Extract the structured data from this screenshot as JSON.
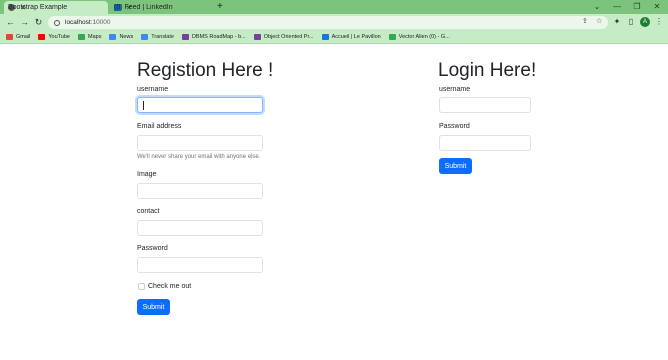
{
  "browser": {
    "tabs": [
      {
        "title": "Bootstrap Example",
        "active": true
      },
      {
        "title": "(0) Feed | LinkedIn",
        "active": false
      }
    ],
    "new_tab": "+",
    "window_controls": [
      "⌄",
      "—",
      "❐",
      "✕"
    ],
    "nav": {
      "back": "←",
      "forward": "→",
      "reload": "↻"
    },
    "address": {
      "host": "localhost",
      "port": ":10000"
    },
    "profile_initial": "A",
    "bookmarks": [
      {
        "label": "Gmail",
        "color": "#ea4335"
      },
      {
        "label": "YouTube",
        "color": "#ff0000"
      },
      {
        "label": "Maps",
        "color": "#34a853"
      },
      {
        "label": "News",
        "color": "#4285f4"
      },
      {
        "label": "Translate",
        "color": "#4285f4"
      },
      {
        "label": "DBMS RoadMap - b...",
        "color": "#7b3fa0"
      },
      {
        "label": "Object Oriented Pr...",
        "color": "#7b3fa0"
      },
      {
        "label": "Accueil | Le Pavillon",
        "color": "#1a73e8"
      },
      {
        "label": "Vector Alien (0) - G...",
        "color": "#34a853"
      }
    ]
  },
  "registration": {
    "title": "Registion Here !",
    "username_label": "username",
    "email_label": "Email address",
    "email_help": "We'll never share your email with anyone else.",
    "image_label": "Image",
    "contact_label": "contact",
    "password_label": "Password",
    "check_label": "Check me out",
    "submit_label": "Submit"
  },
  "login": {
    "title": "Login Here!",
    "username_label": "username",
    "password_label": "Password",
    "submit_label": "Submit"
  },
  "colors": {
    "chrome": "#7cc47c",
    "toolbar": "#c6ecc6",
    "primary": "#0d6efd"
  }
}
